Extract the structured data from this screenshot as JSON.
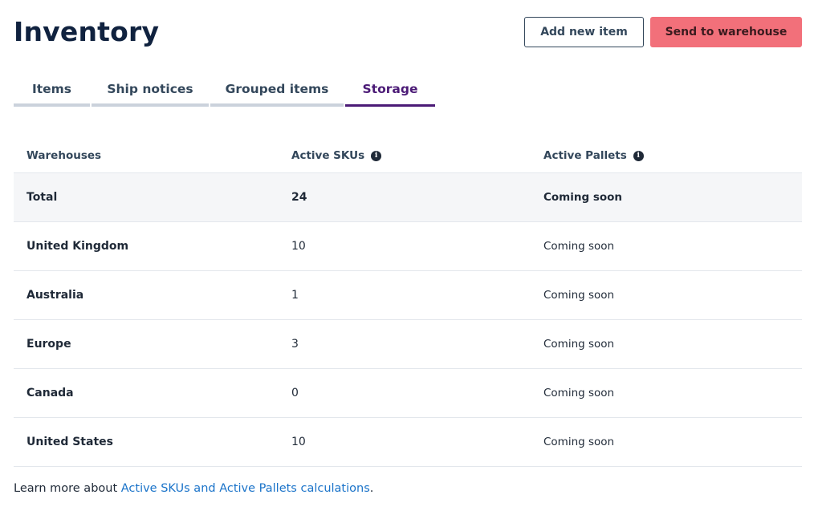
{
  "header": {
    "title": "Inventory",
    "add_button": "Add new item",
    "send_button": "Send to warehouse"
  },
  "tabs": [
    {
      "label": "Items",
      "active": false
    },
    {
      "label": "Ship notices",
      "active": false
    },
    {
      "label": "Grouped items",
      "active": false
    },
    {
      "label": "Storage",
      "active": true
    }
  ],
  "table": {
    "columns": [
      "Warehouses",
      "Active SKUs",
      "Active Pallets"
    ],
    "total": {
      "warehouse": "Total",
      "skus": "24",
      "pallets": "Coming soon"
    },
    "rows": [
      {
        "warehouse": "United Kingdom",
        "skus": "10",
        "pallets": "Coming soon"
      },
      {
        "warehouse": "Australia",
        "skus": "1",
        "pallets": "Coming soon"
      },
      {
        "warehouse": "Europe",
        "skus": "3",
        "pallets": "Coming soon"
      },
      {
        "warehouse": "Canada",
        "skus": "0",
        "pallets": "Coming soon"
      },
      {
        "warehouse": "United States",
        "skus": "10",
        "pallets": "Coming soon"
      }
    ]
  },
  "footer": {
    "prefix": "Learn more about ",
    "link": "Active SKUs and Active Pallets calculations",
    "suffix": "."
  },
  "icons": {
    "info": "info-icon"
  },
  "colors": {
    "primary_button": "#f2707a",
    "active_tab": "#4b1a76",
    "link": "#1a73c9"
  }
}
